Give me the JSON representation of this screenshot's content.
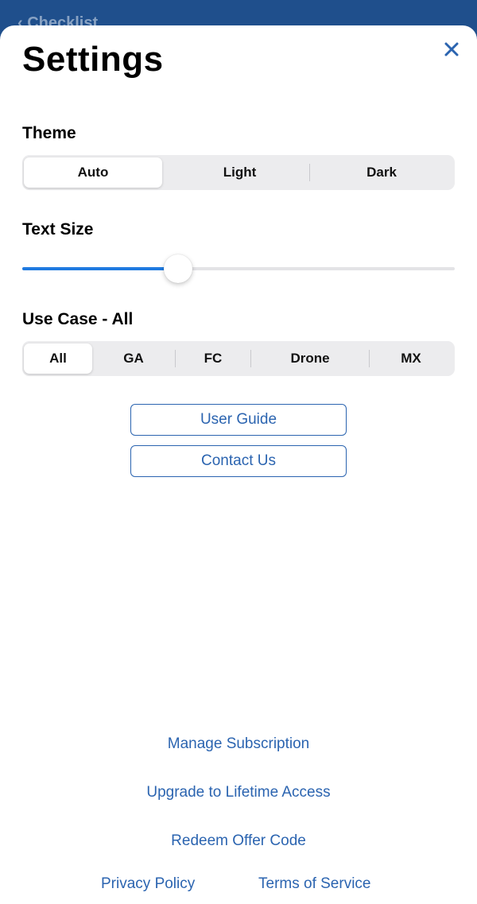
{
  "backdrop": {
    "hint_text": "‹ Checklist"
  },
  "settings": {
    "title": "Settings",
    "close_icon": "close-icon"
  },
  "theme": {
    "label": "Theme",
    "options": [
      "Auto",
      "Light",
      "Dark"
    ],
    "selected": "Auto"
  },
  "text_size": {
    "label": "Text Size",
    "value_fraction": 0.36
  },
  "use_case": {
    "label": "Use Case - All",
    "options": [
      "All",
      "GA",
      "FC",
      "Drone",
      "MX"
    ],
    "selected": "All"
  },
  "buttons": {
    "user_guide": "User Guide",
    "contact_us": "Contact Us"
  },
  "footer": {
    "manage_subscription": "Manage Subscription",
    "upgrade": "Upgrade to Lifetime Access",
    "redeem": "Redeem Offer Code",
    "privacy": "Privacy Policy",
    "terms": "Terms of Service"
  },
  "colors": {
    "accent": "#2b64b0",
    "slider_fill": "#1f7ae0",
    "header_bg": "#1f4f8c"
  }
}
